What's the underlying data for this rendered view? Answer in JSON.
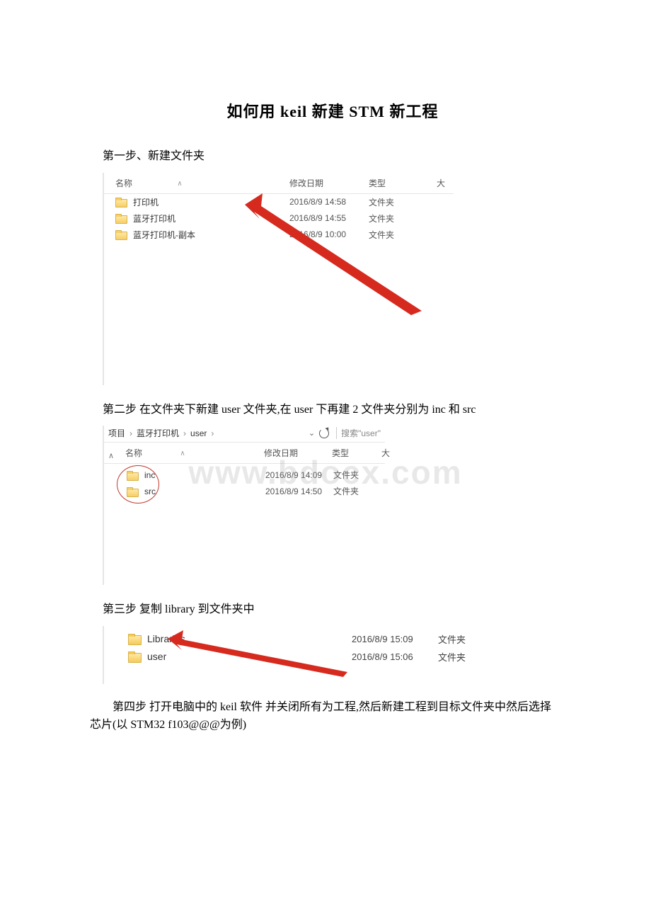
{
  "title_parts": {
    "pre": "如何用 ",
    "kw1": "keil ",
    "mid": "新建 ",
    "kw2": "STM ",
    "post": "新工程"
  },
  "watermark": "www.bdocx.com",
  "steps": {
    "s1": "第一步、新建文件夹",
    "s2": "第二步 在文件夹下新建 user 文件夹,在 user 下再建 2 文件夹分别为 inc 和 src",
    "s3": "第三步 复制 library 到文件夹中",
    "s4": "第四步 打开电脑中的 keil 软件 并关闭所有为工程,然后新建工程到目标文件夹中然后选择芯片(以 STM32 f103@@@为例)"
  },
  "headers": {
    "name": "名称",
    "date": "修改日期",
    "type": "类型",
    "size_trunc": "大"
  },
  "panel1": {
    "rows": [
      {
        "name": "打印机",
        "date": "2016/8/9 14:58",
        "type": "文件夹"
      },
      {
        "name": "蓝牙打印机",
        "date": "2016/8/9 14:55",
        "type": "文件夹"
      },
      {
        "name": "蓝牙打印机-副本",
        "date": "2016/8/9 10:00",
        "type": "文件夹"
      }
    ]
  },
  "panel2": {
    "breadcrumb": {
      "a": "项目",
      "b": "蓝牙打印机",
      "c": "user"
    },
    "search_placeholder": "搜索\"user\"",
    "rows": [
      {
        "name": "inc",
        "date": "2016/8/9 14:09",
        "type": "文件夹"
      },
      {
        "name": "src",
        "date": "2016/8/9 14:50",
        "type": "文件夹"
      }
    ]
  },
  "panel3": {
    "rows": [
      {
        "name": "Libraries",
        "date": "2016/8/9 15:09",
        "type": "文件夹"
      },
      {
        "name": "user",
        "date": "2016/8/9 15:06",
        "type": "文件夹"
      }
    ]
  }
}
